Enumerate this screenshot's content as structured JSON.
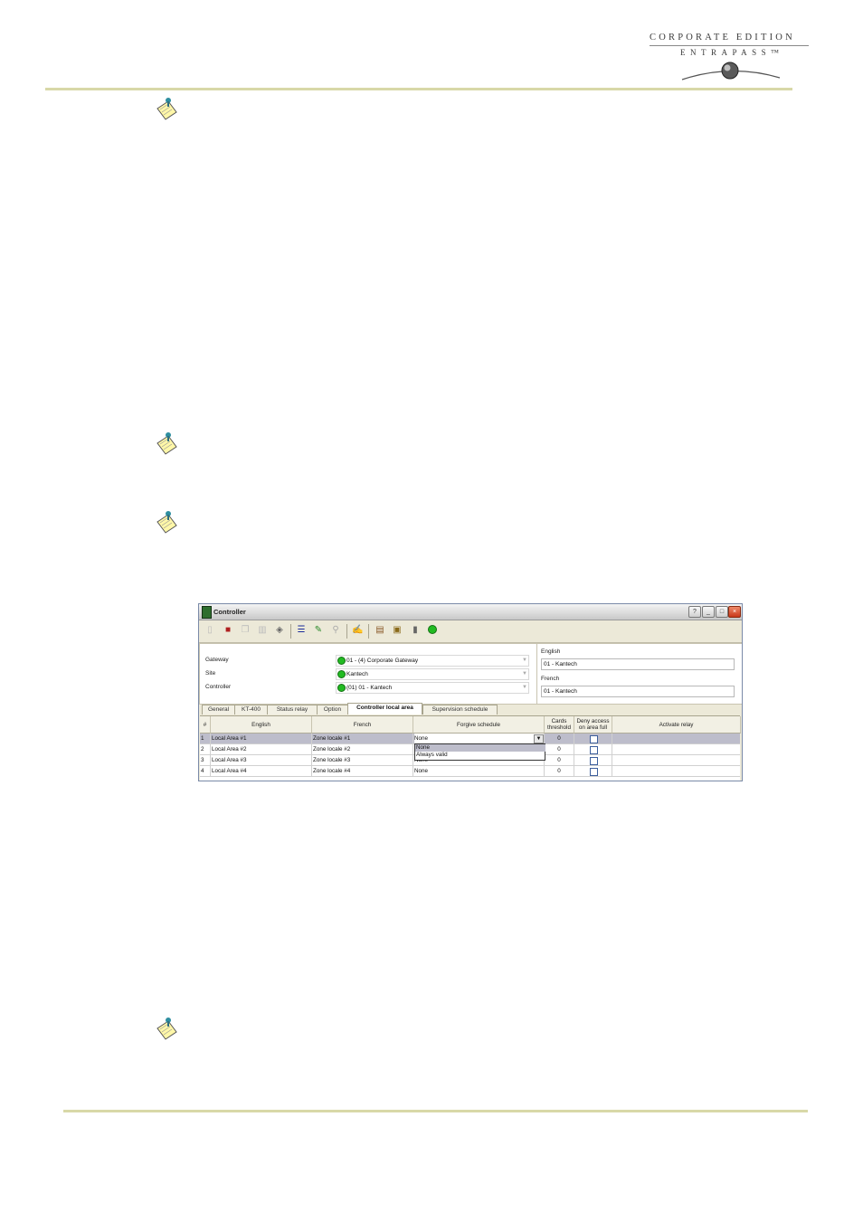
{
  "header": {
    "logo_line1": "CORPORATE EDITION",
    "logo_line2": "ENTRAPASS™"
  },
  "window": {
    "title": "Controller",
    "buttons": [
      "?",
      "_",
      "□",
      "×"
    ],
    "toolbar_icons": [
      "new-icon",
      "save-icon",
      "copy-icon",
      "delete-icon",
      "print-icon",
      "list-icon",
      "link-icon",
      "search-icon",
      "edit-icon",
      "door-icon",
      "reload-icon",
      "device-icon",
      "status-dot-icon"
    ],
    "form": {
      "gateway_label": "Gateway",
      "gateway_value": "01 - (4) Corporate Gateway",
      "site_label": "Site",
      "site_value": "Kantech",
      "controller_label": "Controller",
      "controller_value": "(01) 01 - Kantech"
    },
    "names": {
      "english_label": "English",
      "english_value": "01 - Kantech",
      "french_label": "French",
      "french_value": "01 - Kantech"
    },
    "tabs": [
      "General",
      "KT-400",
      "Status relay",
      "Option",
      "Controller local area",
      "Supervision schedule"
    ],
    "active_tab": "Controller local area",
    "grid": {
      "headers": [
        "#",
        "English",
        "French",
        "Forgive schedule",
        "Cards threshold",
        "Deny access on area full",
        "Activate relay"
      ],
      "rows": [
        {
          "num": "1",
          "english": "Local Area #1",
          "french": "Zone locale #1",
          "schedule": "None",
          "threshold": "0"
        },
        {
          "num": "2",
          "english": "Local Area #2",
          "french": "Zone locale #2",
          "schedule": "",
          "threshold": "0"
        },
        {
          "num": "3",
          "english": "Local Area #3",
          "french": "Zone locale #3",
          "schedule": "None",
          "threshold": "0"
        },
        {
          "num": "4",
          "english": "Local Area #4",
          "french": "Zone locale #4",
          "schedule": "None",
          "threshold": "0"
        }
      ],
      "dropdown_options": [
        "None",
        "Always valid"
      ]
    },
    "colors": {
      "status_green": "#22bb22",
      "selected_row": "#bdbdcb",
      "rule_color": "#d8d8a8"
    }
  }
}
